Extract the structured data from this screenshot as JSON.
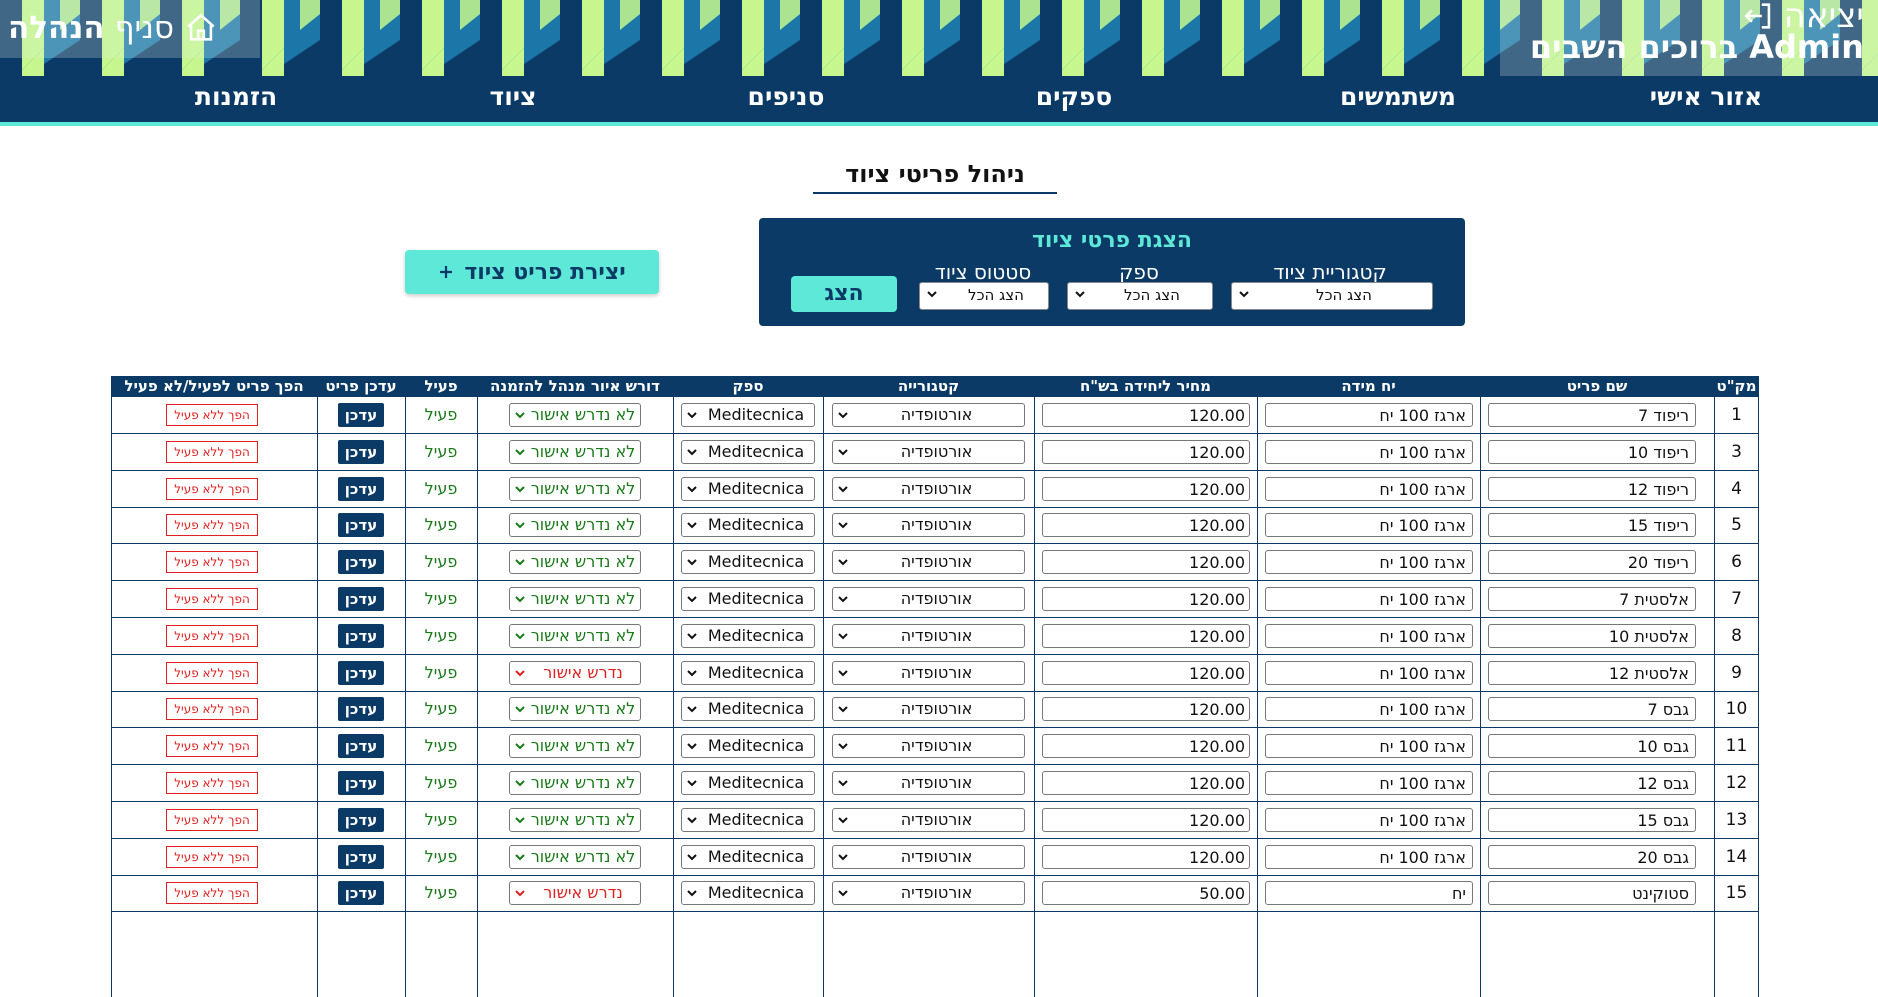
{
  "header": {
    "exit_label": "יציאה",
    "admin_title": "Admin ברוכים השבים",
    "branch_word": "סניף",
    "branch_strong": "הנהלה",
    "colors": {
      "navy": "#0b3a66",
      "teal": "#5ee8d8",
      "lime": "#c6f68d",
      "blue": "#1c76a8"
    }
  },
  "nav": {
    "items": [
      "אזור אישי",
      "משתמשים",
      "ספקים",
      "סניפים",
      "ציוד",
      "הזמנות"
    ]
  },
  "page": {
    "title": "ניהול פריטי ציוד",
    "create_button": "יצירת פריט ציוד",
    "create_icon": "plus-icon"
  },
  "filter": {
    "title": "הצגת פרטי ציוד",
    "category_label": "קטגוריית ציוד",
    "category_value": "הצג הכל",
    "supplier_label": "ספק",
    "supplier_value": "הצג הכל",
    "status_label": "סטטוס ציוד",
    "status_value": "הצג הכל",
    "show_button": "הצג"
  },
  "table": {
    "columns": [
      "מק\"ט",
      "שם פריט",
      "יח מידה",
      "מחיר ליחידה בש\"ח",
      "קטגורייה",
      "ספק",
      "דורש איור מנהל להזמנה",
      "פעיל",
      "עדכן פריט",
      "הפך פריט לפעיל/לא פעיל"
    ],
    "update_label": "עדכן",
    "toggle_label": "הפך ללא פעיל",
    "rows": [
      {
        "sku": "1",
        "name": "ריפוד 7",
        "unit": "ארגז 100 יח",
        "price": "120.00",
        "category": "אורטופדיה",
        "supplier": "Meditecnica",
        "approval": "לא נדרש אישור",
        "approval_required": false,
        "active": "פעיל"
      },
      {
        "sku": "3",
        "name": "ריפוד 10",
        "unit": "ארגז 100 יח",
        "price": "120.00",
        "category": "אורטופדיה",
        "supplier": "Meditecnica",
        "approval": "לא נדרש אישור",
        "approval_required": false,
        "active": "פעיל"
      },
      {
        "sku": "4",
        "name": "ריפוד 12",
        "unit": "ארגז 100 יח",
        "price": "120.00",
        "category": "אורטופדיה",
        "supplier": "Meditecnica",
        "approval": "לא נדרש אישור",
        "approval_required": false,
        "active": "פעיל"
      },
      {
        "sku": "5",
        "name": "ריפוד 15",
        "unit": "ארגז 100 יח",
        "price": "120.00",
        "category": "אורטופדיה",
        "supplier": "Meditecnica",
        "approval": "לא נדרש אישור",
        "approval_required": false,
        "active": "פעיל"
      },
      {
        "sku": "6",
        "name": "ריפוד 20",
        "unit": "ארגז 100 יח",
        "price": "120.00",
        "category": "אורטופדיה",
        "supplier": "Meditecnica",
        "approval": "לא נדרש אישור",
        "approval_required": false,
        "active": "פעיל"
      },
      {
        "sku": "7",
        "name": "אלסטית 7",
        "unit": "ארגז 100 יח",
        "price": "120.00",
        "category": "אורטופדיה",
        "supplier": "Meditecnica",
        "approval": "לא נדרש אישור",
        "approval_required": false,
        "active": "פעיל"
      },
      {
        "sku": "8",
        "name": "אלסטית 10",
        "unit": "ארגז 100 יח",
        "price": "120.00",
        "category": "אורטופדיה",
        "supplier": "Meditecnica",
        "approval": "לא נדרש אישור",
        "approval_required": false,
        "active": "פעיל"
      },
      {
        "sku": "9",
        "name": "אלסטית 12",
        "unit": "ארגז 100 יח",
        "price": "120.00",
        "category": "אורטופדיה",
        "supplier": "Meditecnica",
        "approval": "נדרש אישור",
        "approval_required": true,
        "active": "פעיל"
      },
      {
        "sku": "10",
        "name": "גבס 7",
        "unit": "ארגז 100 יח",
        "price": "120.00",
        "category": "אורטופדיה",
        "supplier": "Meditecnica",
        "approval": "לא נדרש אישור",
        "approval_required": false,
        "active": "פעיל"
      },
      {
        "sku": "11",
        "name": "גבס 10",
        "unit": "ארגז 100 יח",
        "price": "120.00",
        "category": "אורטופדיה",
        "supplier": "Meditecnica",
        "approval": "לא נדרש אישור",
        "approval_required": false,
        "active": "פעיל"
      },
      {
        "sku": "12",
        "name": "גבס 12",
        "unit": "ארגז 100 יח",
        "price": "120.00",
        "category": "אורטופדיה",
        "supplier": "Meditecnica",
        "approval": "לא נדרש אישור",
        "approval_required": false,
        "active": "פעיל"
      },
      {
        "sku": "13",
        "name": "גבס 15",
        "unit": "ארגז 100 יח",
        "price": "120.00",
        "category": "אורטופדיה",
        "supplier": "Meditecnica",
        "approval": "לא נדרש אישור",
        "approval_required": false,
        "active": "פעיל"
      },
      {
        "sku": "14",
        "name": "גבס 20",
        "unit": "ארגז 100 יח",
        "price": "120.00",
        "category": "אורטופדיה",
        "supplier": "Meditecnica",
        "approval": "לא נדרש אישור",
        "approval_required": false,
        "active": "פעיל"
      },
      {
        "sku": "15",
        "name": "סטוקינט",
        "unit": "יח",
        "price": "50.00",
        "category": "אורטופדיה",
        "supplier": "Meditecnica",
        "approval": "נדרש אישור",
        "approval_required": true,
        "active": "פעיל"
      }
    ]
  }
}
